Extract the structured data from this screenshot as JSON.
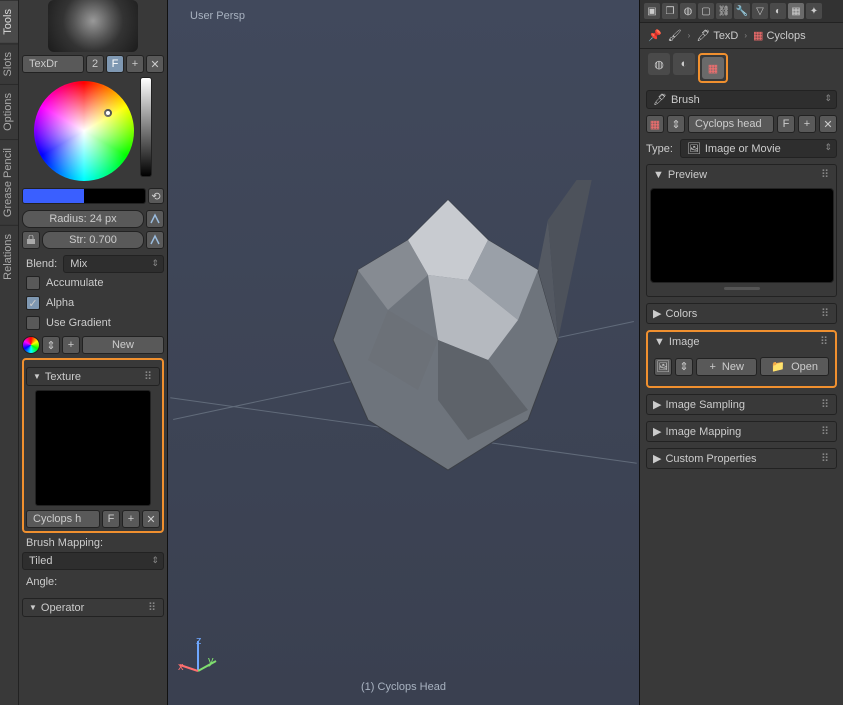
{
  "vtabs": [
    "Tools",
    "Slots",
    "Options",
    "Grease Pencil",
    "Relations"
  ],
  "brush": {
    "slot_name": "TexDr",
    "slot_users": "2",
    "fake": "F",
    "radius": "Radius: 24 px",
    "strength": "Str: 0.700",
    "blend_label": "Blend:",
    "blend_value": "Mix",
    "accumulate": "Accumulate",
    "alpha": "Alpha",
    "use_gradient": "Use Gradient",
    "new": "New"
  },
  "texture": {
    "heading": "Texture",
    "name": "Cyclops h",
    "fake": "F",
    "mapping_label": "Brush Mapping:",
    "mapping_value": "Tiled",
    "angle_label": "Angle:"
  },
  "operator": {
    "heading": "Operator"
  },
  "viewport": {
    "label": "User Persp",
    "object": "(1) Cyclops Head"
  },
  "breadcrumb": {
    "texd": "TexD",
    "cyclops": "Cyclops"
  },
  "brush_data": {
    "label": "Brush"
  },
  "tex_data": {
    "name": "Cyclops head",
    "fake": "F",
    "type_label": "Type:",
    "type_value": "Image or Movie"
  },
  "panels": {
    "preview": "Preview",
    "colors": "Colors",
    "image": "Image",
    "image_sampling": "Image Sampling",
    "image_mapping": "Image Mapping",
    "custom_props": "Custom Properties"
  },
  "image": {
    "new": "New",
    "open": "Open"
  }
}
